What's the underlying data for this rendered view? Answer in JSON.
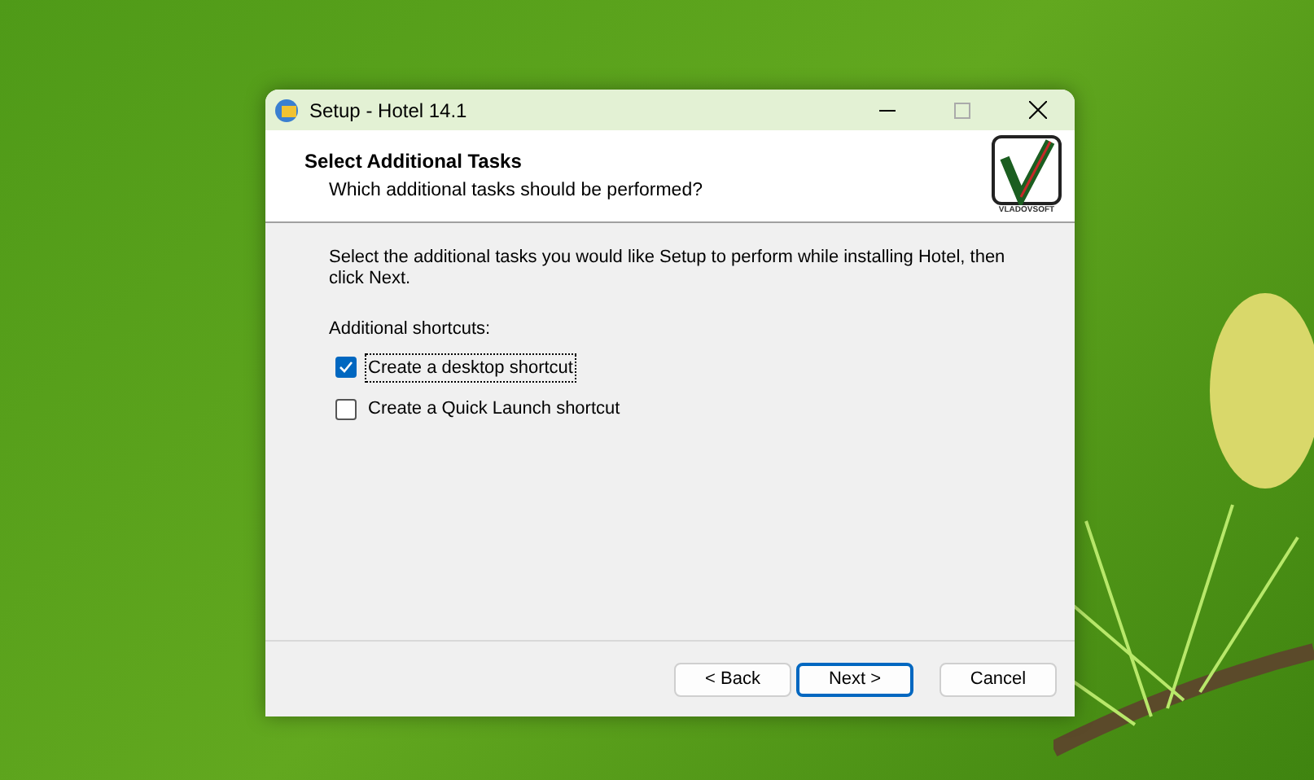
{
  "window": {
    "title": "Setup - Hotel 14.1"
  },
  "header": {
    "title": "Select Additional Tasks",
    "subtitle": "Which additional tasks should be performed?",
    "logo_text": "VLADOVSOFT"
  },
  "body": {
    "intro": "Select the additional tasks you would like Setup to perform while installing Hotel, then click Next.",
    "group_label": "Additional shortcuts:",
    "tasks": [
      {
        "label": "Create a desktop shortcut",
        "checked": true,
        "focused": true
      },
      {
        "label": "Create a Quick Launch shortcut",
        "checked": false,
        "focused": false
      }
    ]
  },
  "buttons": [
    {
      "label": "< Back",
      "default": false
    },
    {
      "label": "Next >",
      "default": true
    },
    {
      "label": "Cancel",
      "default": false
    }
  ]
}
